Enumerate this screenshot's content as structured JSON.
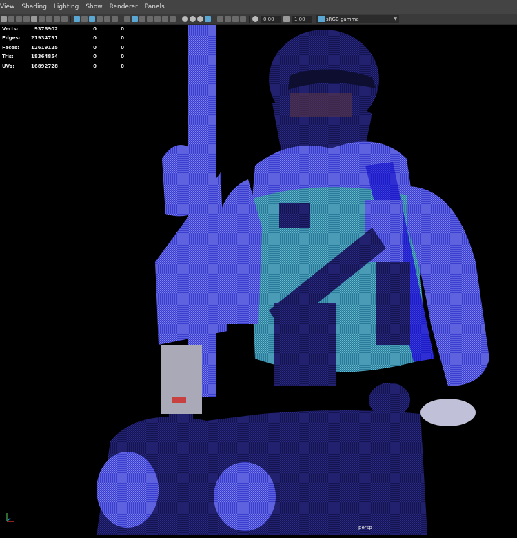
{
  "menu": [
    "View",
    "Shading",
    "Lighting",
    "Show",
    "Renderer",
    "Panels"
  ],
  "toolbar": {
    "field_a": "0.00",
    "field_b": "1.00",
    "color_space": "sRGB gamma"
  },
  "hud": {
    "rows": [
      {
        "label": "Verts:",
        "value": "9378902",
        "sel": "0",
        "comp": "0"
      },
      {
        "label": "Edges:",
        "value": "21934791",
        "sel": "0",
        "comp": "0"
      },
      {
        "label": "Faces:",
        "value": "12619125",
        "sel": "0",
        "comp": "0"
      },
      {
        "label": "Tris:",
        "value": "18364854",
        "sel": "0",
        "comp": "0"
      },
      {
        "label": "UVs:",
        "value": "16892728",
        "sel": "0",
        "comp": "0"
      }
    ]
  },
  "camera": "persp",
  "colors": {
    "menubar": "#444444",
    "toolbar": "#3a3a3a",
    "wire": "#1c1cc8",
    "accent": "#5aa7d4"
  }
}
